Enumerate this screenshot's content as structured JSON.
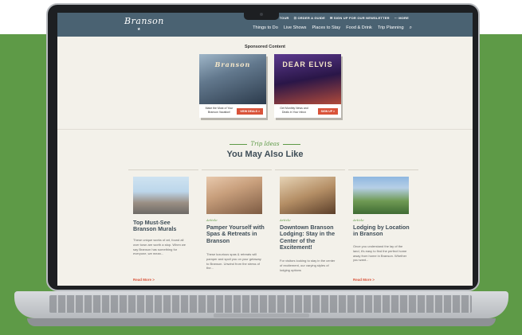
{
  "page": {
    "background_color": "#5e9a47"
  },
  "header": {
    "logo": "Branson",
    "top_links": [
      "TOUR",
      "⊡ ORDER A GUIDE",
      "✉ SIGN UP FOR OUR NEWSLETTER",
      "⋯ MORE"
    ],
    "nav": [
      "Things to Do",
      "Live Shows",
      "Places to Stay",
      "Food & Drink",
      "Trip Planning"
    ],
    "search_icon": "search-icon"
  },
  "sponsored": {
    "title": "Sponsored Content",
    "cards": [
      {
        "image_text": "Branson",
        "caption": "Make the Most of Your Branson Vacation!",
        "button": "VIEW DEALS >"
      },
      {
        "image_text": "DEAR ELVIS",
        "caption": "Get Monthly News and Deals in Your Inbox",
        "button": "SIGN UP >"
      }
    ]
  },
  "trip_ideas": {
    "label": "Trip Ideas",
    "heading": "You May Also Like",
    "articles": [
      {
        "tag": "",
        "title": "Top Must-See Branson Murals",
        "desc": "These unique works of art, found all over town are worth a stop. When we say Branson has something for everyone, we mean...",
        "more": "Read More >"
      },
      {
        "tag": "Article",
        "title": "Pamper Yourself with Spas & Retreats in Branson",
        "desc": "These luxurious spas & retreats will pamper and spoil you on your getaway to Branson. Unwind from the stress of the...",
        "more": ""
      },
      {
        "tag": "Article",
        "title": "Downtown Branson Lodging: Stay in the Center of the Excitement!",
        "desc": "For visitors looking to stay in the center of excitement, our varying styles of lodging options",
        "more": ""
      },
      {
        "tag": "Article",
        "title": "Lodging by Location in Branson",
        "desc": "Once you understand the lay of the land, it's easy to find the perfect home away from home in Branson. Whether you want...",
        "more": "Read More >"
      }
    ]
  }
}
